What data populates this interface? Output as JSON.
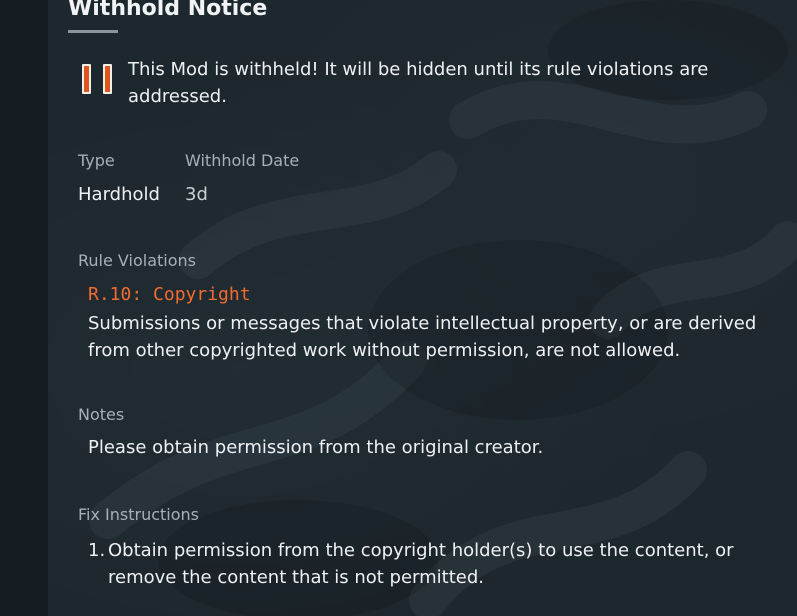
{
  "notice": {
    "title": "Withhold Notice",
    "message": "This Mod is withheld! It will be hidden until its rule violations are addressed."
  },
  "details": {
    "type_label": "Type",
    "type_value": "Hardhold",
    "date_label": "Withhold Date",
    "date_value": "3d"
  },
  "violations": {
    "label": "Rule Violations",
    "items": [
      {
        "code": "R.10: Copyright",
        "description": "Submissions or messages that violate intellectual property, or are derived from other copyrighted work without permission, are not allowed."
      }
    ]
  },
  "notes": {
    "label": "Notes",
    "text": "Please obtain permission from the original creator."
  },
  "fix": {
    "label": "Fix Instructions",
    "items": [
      {
        "number": "1.",
        "text": "Obtain permission from the copyright holder(s) to use the content, or remove the content that is not permitted."
      }
    ]
  },
  "colors": {
    "accent": "#f26b2f",
    "pause_icon": "#e0551f",
    "background": "#1c252b"
  },
  "icons": {
    "status": "pause-icon"
  }
}
